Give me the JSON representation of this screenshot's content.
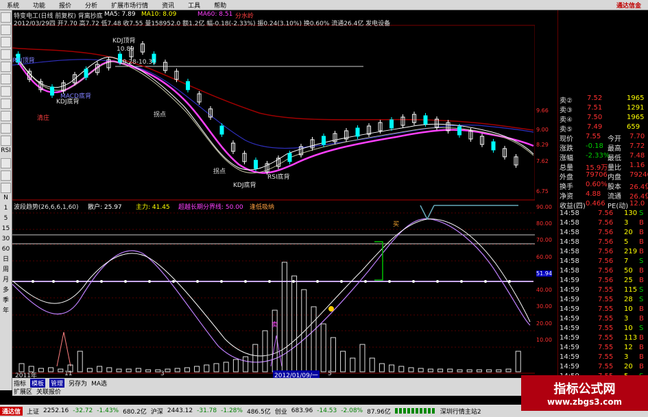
{
  "menu": {
    "items": [
      "系统",
      "功能",
      "报价",
      "分析",
      "扩展市场行情",
      "资讯",
      "工具",
      "帮助"
    ],
    "brand": "通达信金"
  },
  "left_toolbar": {
    "labels": [
      "RSI",
      "N",
      "1",
      "5",
      "15",
      "30",
      "60",
      "日",
      "周",
      "月",
      "多",
      "季",
      "年"
    ]
  },
  "header": {
    "line1": "特变电工(日线 前复权) 背离抄底",
    "ma5": "MA5: 7.89",
    "ma10": "MA10: 8.09",
    "ma60": "MA60: 8.51",
    "split": "分水岭",
    "line2": "2012/03/29四 开7.70 高7.72 低7.48 收7.55 量158952.0 额1.2亿 幅-0.18(-2.33%) 振0.24(3.10%) 换0.60% 流通26.4亿 发电设备"
  },
  "annotations": {
    "top1": "KDJ顶背",
    "price_high": "10.89",
    "range": "10.28-10.31",
    "macd_bottom": "MACD底背",
    "kdj_bottom1": "KDJ底背",
    "signal1": "清庄",
    "turn1": "拐点",
    "turn2": "拐点",
    "kdj_bottom2": "KDJ底背",
    "rsi_bottom": "RSI底背",
    "rsi_top": "RSI顶背"
  },
  "sub_header": {
    "name": "波段趋势(26,6,6,1,60)",
    "buy": "散户: 25.97",
    "sell": "主力: 41.45",
    "warn": "超越长期分界线: 50.00",
    "note": "逢低吸纳"
  },
  "sub_labels": {
    "buy": "买",
    "sell": "卖",
    "value": "51.94"
  },
  "right_axis": {
    "price": [
      "9.66",
      "9.00",
      "8.29",
      "7.62",
      "6.75"
    ],
    "sub": [
      "90.00",
      "80.00",
      "70.00",
      "60.00",
      "50.00",
      "40.00",
      "30.00",
      "20.00",
      "10.00"
    ]
  },
  "quote": {
    "asks": [
      {
        "label": "卖②",
        "price": "7.52",
        "vol": "1965"
      },
      {
        "label": "卖③",
        "price": "7.51",
        "vol": "1291"
      },
      {
        "label": "卖④",
        "price": "7.50",
        "vol": "1965"
      },
      {
        "label": "卖⑤",
        "price": "7.49",
        "vol": "659"
      }
    ],
    "stats": [
      {
        "l1": "现价",
        "v1": "7.55",
        "l2": "今开",
        "v2": "7.70"
      },
      {
        "l1": "涨跌",
        "v1": "-0.18",
        "l2": "最高",
        "v2": "7.72"
      },
      {
        "l1": "涨幅",
        "v1": "-2.33%",
        "l2": "最低",
        "v2": "7.48"
      },
      {
        "l1": "总量",
        "v1": "15.9万",
        "l2": "量比",
        "v2": "1.16"
      },
      {
        "l1": "外盘",
        "v1": "79706",
        "l2": "内盘",
        "v2": "79246"
      },
      {
        "l1": "换手",
        "v1": "0.60%",
        "l2": "股本",
        "v2": "26.4亿"
      },
      {
        "l1": "净资",
        "v1": "4.88",
        "l2": "流通",
        "v2": "26.4亿"
      },
      {
        "l1": "收益(四)",
        "v1": "0.466",
        "l2": "PE(动)",
        "v2": "12.0"
      }
    ],
    "ticks": [
      {
        "t": "14:58",
        "p": "7.56",
        "v": "130",
        "d": "S"
      },
      {
        "t": "14:58",
        "p": "7.56",
        "v": "3",
        "d": "B"
      },
      {
        "t": "14:58",
        "p": "7.56",
        "v": "20",
        "d": "B"
      },
      {
        "t": "14:58",
        "p": "7.56",
        "v": "5",
        "d": "B"
      },
      {
        "t": "14:58",
        "p": "7.56",
        "v": "219",
        "d": "B"
      },
      {
        "t": "14:58",
        "p": "7.56",
        "v": "7",
        "d": "S"
      },
      {
        "t": "14:58",
        "p": "7.56",
        "v": "50",
        "d": "B"
      },
      {
        "t": "14:59",
        "p": "7.56",
        "v": "25",
        "d": "B"
      },
      {
        "t": "14:59",
        "p": "7.55",
        "v": "115",
        "d": "S"
      },
      {
        "t": "14:59",
        "p": "7.55",
        "v": "28",
        "d": "S"
      },
      {
        "t": "14:59",
        "p": "7.55",
        "v": "10",
        "d": "B"
      },
      {
        "t": "14:59",
        "p": "7.55",
        "v": "3",
        "d": "B"
      },
      {
        "t": "14:59",
        "p": "7.55",
        "v": "10",
        "d": "S"
      },
      {
        "t": "14:59",
        "p": "7.55",
        "v": "113",
        "d": "B"
      },
      {
        "t": "14:59",
        "p": "7.55",
        "v": "12",
        "d": "B"
      },
      {
        "t": "14:59",
        "p": "7.55",
        "v": "3",
        "d": "B"
      },
      {
        "t": "14:59",
        "p": "7.55",
        "v": "20",
        "d": "B"
      },
      {
        "t": "14:59",
        "p": "7.55",
        "v": "5",
        "d": "S"
      }
    ]
  },
  "timeline": {
    "y2011": "2011年",
    "m1": "11",
    "m3": "3",
    "date": "2012/01/09/一",
    "m5": "5"
  },
  "tabs": {
    "items": [
      "指标",
      "模板",
      "管理",
      "另存为",
      "MA选"
    ],
    "row2": [
      "扩展区",
      "关联报价"
    ]
  },
  "status": {
    "brand": "通达信",
    "sh": "上证",
    "sh_val": "2252.16",
    "sh_chg": "-32.72",
    "sh_pct": "-1.43%",
    "sh_amt": "680.2亿",
    "hs": "沪深",
    "hs_val": "2443.12",
    "hs_chg": "-31.78",
    "hs_pct": "-1.28%",
    "hs_amt": "486.5亿",
    "cy": "创业",
    "cy_val": "683.96",
    "cy_chg": "-14.53",
    "cy_pct": "-2.08%",
    "cy_amt": "87.96亿",
    "server": "深圳行情主站2"
  },
  "watermark": {
    "title": "指标公式网",
    "url": "www.zbgs3.com"
  },
  "colors": {
    "up": "#ff3030",
    "down": "#00ffff",
    "ma5": "#ffffff",
    "ma10": "#ffff00",
    "ma60": "#ff00ff",
    "split": "#a00000"
  }
}
